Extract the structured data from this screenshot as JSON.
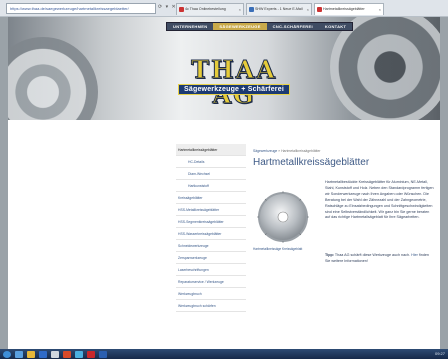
{
  "browser": {
    "url": "https://www.thaa.de/saegewerkzeuge/hartmetallkreissaegeblaetter/",
    "tabs": [
      {
        "label": "4c Thaa Onlinebestellung"
      },
      {
        "label": "SHW Experts - 1 Neue E-Mail"
      },
      {
        "label": "Hartmetallkreissägeblätter"
      }
    ]
  },
  "site": {
    "nav": [
      "UNTERNEHMEN",
      "SÄGEWERKZEUGE",
      "CNC-SCHÄRFEREI",
      "KONTAKT"
    ],
    "logo": "THAA AG",
    "tagline": "Sägewerkzeuge + Schärferei"
  },
  "sidebar": {
    "items": [
      {
        "label": "Hartmetallkreissägeblätter"
      },
      {
        "label": "HC-Details"
      },
      {
        "label": "Diam-Wechsel"
      },
      {
        "label": "Hartkunststoff"
      },
      {
        "label": "Kreissägeblätter"
      },
      {
        "label": "HSS-Metallkreissägeblätter"
      },
      {
        "label": "HSS-Segmentkreissägeblätter"
      },
      {
        "label": "HSS-Wasserkreissägeblätter"
      },
      {
        "label": "Schneidewerkzeuge"
      },
      {
        "label": "Zerspanwerkzeuge"
      },
      {
        "label": "Laserbeschriftungen"
      },
      {
        "label": "Reparaturservice / Werkzeuge"
      },
      {
        "label": "Werkzeugbruch"
      },
      {
        "label": "Werkzeugbruch schärfen"
      }
    ]
  },
  "content": {
    "breadcrumb_link": "Sägewerkzeuge",
    "breadcrumb_current": "Hartmetallkreissägeblätter",
    "title": "Hartmetallkreissägeblätter",
    "image_caption": "Hartmetallkreissäge Kreissägeblatt",
    "description": "Hartmetallbestückte Kreissägeblätter für Aluminium, NE-Metall, Stahl, Kunststoff und Holz. Neben den Standardprogramm fertigen wir Sonderwerkzeuge nach Ihren Angaben oder Wünschen. Die Beratung bei der Wahl der Zähnezahl und der Zahngeometrie, Ratschläge zu Einsatzbedingungen und Schnittgeschwindigkeiten sind eine Selbstverständlichkeit. Wir ganz bin Sie gerne beraten auf das richtige Hartmetallsägeblatt für Ihre Sägearbeiten.",
    "tip_label": "Tipp:",
    "tip_text": "Thaa AG schärft diese Werkzeuge auch nach.",
    "tip_link": "Hier",
    "tip_suffix": "finden Sie weitere Informationen!"
  },
  "taskbar": {
    "clock": "09:27"
  }
}
